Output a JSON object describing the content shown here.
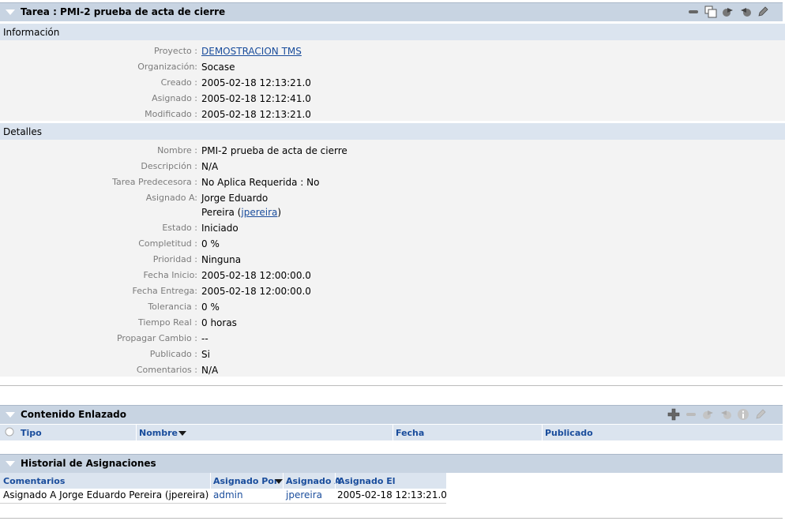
{
  "task_panel": {
    "title": "Tarea : PMI-2 prueba de acta de cierre",
    "icons": [
      "minimize-icon",
      "restore-icon",
      "forward-icon",
      "back-icon",
      "edit-icon"
    ]
  },
  "info_section": {
    "title": "Información",
    "rows": [
      {
        "label": "Proyecto :",
        "value": "DEMOSTRACION TMS",
        "link": true
      },
      {
        "label": "Organización:",
        "value": "Socase"
      },
      {
        "label": "Creado :",
        "value": "2005-02-18 12:13:21.0"
      },
      {
        "label": "Asignado :",
        "value": "2005-02-18 12:12:41.0"
      },
      {
        "label": "Modificado :",
        "value": "2005-02-18 12:13:21.0"
      }
    ]
  },
  "details_section": {
    "title": "Detalles",
    "nombre_label": "Nombre :",
    "nombre": "PMI-2 prueba de acta de cierre",
    "descripcion_label": "Descripción :",
    "descripcion": "N/A",
    "predecesora_label": "Tarea Predecesora :",
    "predecesora": "No Aplica Requerida : No",
    "asignado_label": "Asignado A:",
    "asignado_line1": "Jorge Eduardo",
    "asignado_line2_prefix": "Pereira (",
    "asignado_user": "jpereira",
    "asignado_line2_suffix": ")",
    "estado_label": "Estado :",
    "estado": "Iniciado",
    "completitud_label": "Completitud :",
    "completitud": "0 %",
    "prioridad_label": "Prioridad :",
    "prioridad": "Ninguna",
    "inicio_label": "Fecha Inicio:",
    "inicio": "2005-02-18 12:00:00.0",
    "entrega_label": "Fecha Entrega:",
    "entrega": "2005-02-18 12:00:00.0",
    "tolerancia_label": "Tolerancia :",
    "tolerancia": "0 %",
    "tiempo_label": "Tiempo Real :",
    "tiempo": "0 horas",
    "propagar_label": "Propagar Cambio :",
    "propagar": "--",
    "publicado_label": "Publicado :",
    "publicado": "Si",
    "comentarios_label": "Comentarios :",
    "comentarios": "N/A"
  },
  "linked_content": {
    "title": "Contenido Enlazado",
    "icons": [
      "add-icon",
      "remove-icon",
      "forward-icon",
      "back-icon",
      "info-icon",
      "edit-icon"
    ],
    "columns": {
      "tipo": "Tipo",
      "nombre": "Nombre",
      "fecha": "Fecha",
      "publicado": "Publicado"
    }
  },
  "history": {
    "title": "Historial de Asignaciones",
    "columns": {
      "comentarios": "Comentarios",
      "asignado_por": "Asignado Por",
      "asignado_a": "Asignado A",
      "asignado_el": "Asignado El"
    },
    "row": {
      "comentarios": "Asignado A Jorge Eduardo Pereira (jpereira)",
      "asignado_por": "admin",
      "asignado_a": "jpereira",
      "asignado_el": "2005-02-18 12:13:21.0"
    }
  },
  "colors": {
    "header": "#c8d4e2",
    "band": "#dbe4ef",
    "link": "#1a4d9c"
  }
}
